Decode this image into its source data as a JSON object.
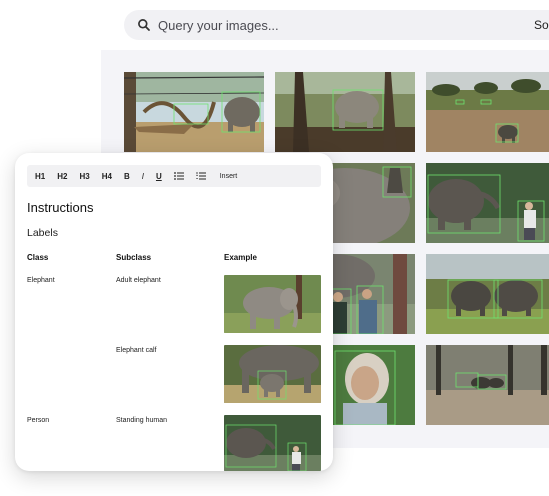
{
  "search": {
    "placeholder": "Query your images...",
    "sort_label": "Sor"
  },
  "gallery": {
    "tiles": [
      {
        "name": "elephant-fence",
        "icon": "image-thumbnail"
      },
      {
        "name": "elephant-forest",
        "icon": "image-thumbnail"
      },
      {
        "name": "elephant-savanna",
        "icon": "image-thumbnail"
      },
      {
        "name": "elephant-closeup",
        "icon": "image-thumbnail"
      },
      {
        "name": "elephant-feeding",
        "icon": "image-thumbnail"
      },
      {
        "name": "people-elephant",
        "icon": "image-thumbnail"
      },
      {
        "name": "elephants-pair",
        "icon": "image-thumbnail"
      },
      {
        "name": "woman-portrait",
        "icon": "image-thumbnail"
      },
      {
        "name": "elephant-herd",
        "icon": "image-thumbnail"
      }
    ]
  },
  "card": {
    "toolbar": {
      "h1": "H1",
      "h2": "H2",
      "h3": "H3",
      "h4": "H4",
      "bold": "B",
      "italic": "I",
      "underline": "U",
      "insert": "Insert"
    },
    "heading": "Instructions",
    "subheading": "Labels",
    "columns": {
      "class": "Class",
      "subclass": "Subclass",
      "example": "Example"
    },
    "rows": [
      {
        "class": "Elephant",
        "subclass": "Adult elephant"
      },
      {
        "class": "",
        "subclass": "Elephant calf"
      },
      {
        "class": "Person",
        "subclass": "Standing human"
      }
    ]
  }
}
